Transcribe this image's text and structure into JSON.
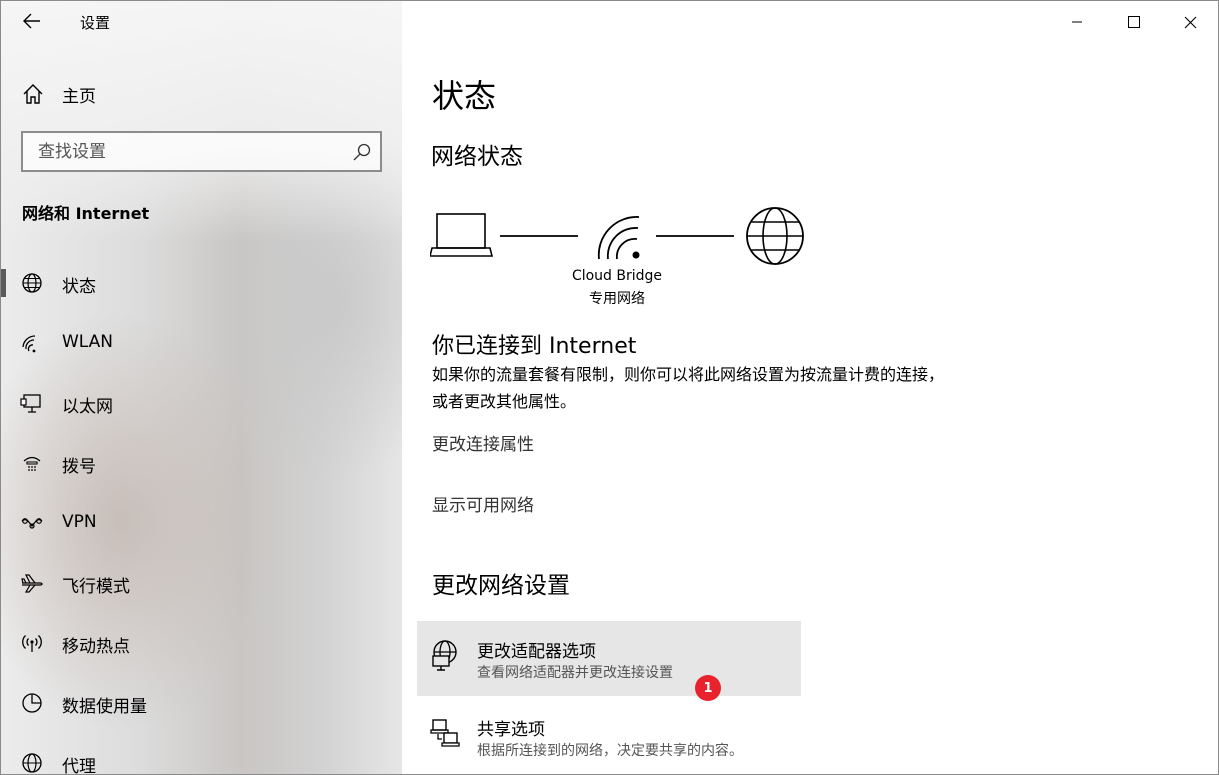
{
  "window": {
    "title": "设置",
    "controls": {
      "minimize": "minimize-icon",
      "maximize": "maximize-icon",
      "close": "close-icon"
    }
  },
  "sidebar": {
    "home_label": "主页",
    "search_placeholder": "查找设置",
    "section_title": "网络和 Internet",
    "items": [
      {
        "label": "状态",
        "icon": "globe-icon",
        "active": true
      },
      {
        "label": "WLAN",
        "icon": "wifi-icon"
      },
      {
        "label": "以太网",
        "icon": "ethernet-icon"
      },
      {
        "label": "拨号",
        "icon": "dialup-icon"
      },
      {
        "label": "VPN",
        "icon": "vpn-icon"
      },
      {
        "label": "飞行模式",
        "icon": "airplane-icon"
      },
      {
        "label": "移动热点",
        "icon": "hotspot-icon"
      },
      {
        "label": "数据使用量",
        "icon": "data-usage-icon"
      },
      {
        "label": "代理",
        "icon": "proxy-globe-icon"
      }
    ]
  },
  "main": {
    "page_title": "状态",
    "network_status_title": "网络状态",
    "network_name": "Cloud Bridge",
    "network_type": "专用网络",
    "connected_title": "你已连接到 Internet",
    "connected_desc": "如果你的流量套餐有限制，则你可以将此网络设置为按流量计费的连接，或者更改其他属性。",
    "link_change_properties": "更改连接属性",
    "link_show_networks": "显示可用网络",
    "change_settings_title": "更改网络设置",
    "options": [
      {
        "title": "更改适配器选项",
        "desc": "查看网络适配器并更改连接设置",
        "icon": "adapter-icon"
      },
      {
        "title": "共享选项",
        "desc": "根据所连接到的网络，决定要共享的内容。",
        "icon": "sharing-icon"
      }
    ],
    "badge": "1"
  }
}
